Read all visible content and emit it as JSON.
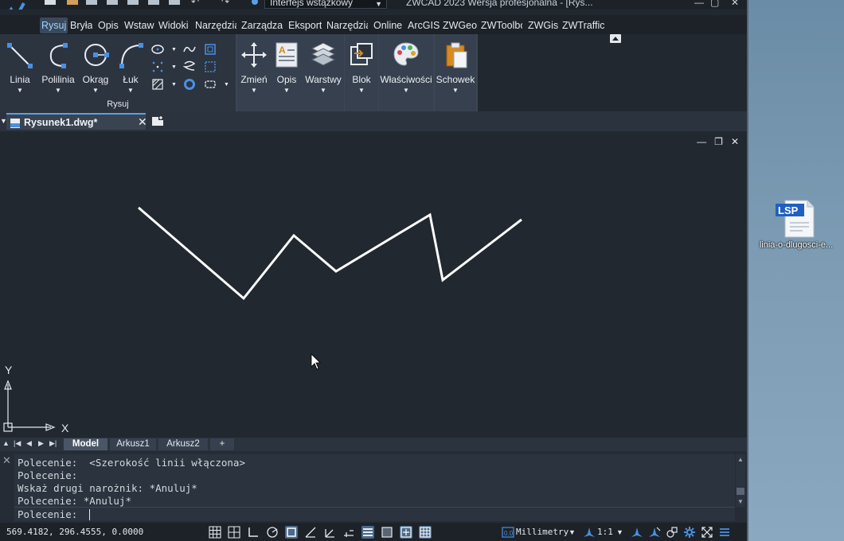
{
  "window": {
    "workspace": "Interfejs wstążkowy",
    "title": "ZWCAD 2023 Wersja profesjonalna - [Rys..."
  },
  "menu": {
    "items": [
      "Rysuj",
      "Bryła",
      "Opis",
      "Wstaw",
      "Widoki",
      "Narzędzia",
      "Zarządzar",
      "Eksport",
      "Narzędzia",
      "Online",
      "ArcGIS",
      "ZWGeo",
      "ZWToolbo",
      "ZWGis",
      "ZWTraffic"
    ],
    "active": "Rysuj"
  },
  "ribbon": {
    "draw_panel_title": "Rysuj",
    "buttons": {
      "linia": "Linia",
      "polilinia": "Polilinia",
      "okrag": "Okrąg",
      "luk": "Łuk",
      "zmien": "Zmień",
      "opis": "Opis",
      "warstwy": "Warstwy",
      "blok": "Blok",
      "wlasciwosci": "Właściwości",
      "schowek": "Schowek"
    }
  },
  "document": {
    "tab_label": "Rysunek1.dwg*"
  },
  "ucs": {
    "y_label": "Y",
    "x_label": "X"
  },
  "layout_tabs": {
    "tabs": [
      "Model",
      "Arkusz1",
      "Arkusz2"
    ],
    "add": "+",
    "active": "Model"
  },
  "command": {
    "history": [
      "Polecenie:  <Szerokość linii włączona>",
      "Polecenie:",
      "Wskaż drugi narożnik: *Anuluj*",
      "Polecenie: *Anuluj*"
    ],
    "prompt": "Polecenie: "
  },
  "status": {
    "coords": "569.4182, 296.4555, 0.0000",
    "units": "Millimetry",
    "scale": "1:1"
  },
  "desktop": {
    "file_label": "linia-o-dlugosci-e...",
    "file_badge": "LSP"
  },
  "colors": {
    "canvas_bg": "#212830",
    "accent": "#5aa0e6",
    "drawing_line": "#ffffff"
  }
}
